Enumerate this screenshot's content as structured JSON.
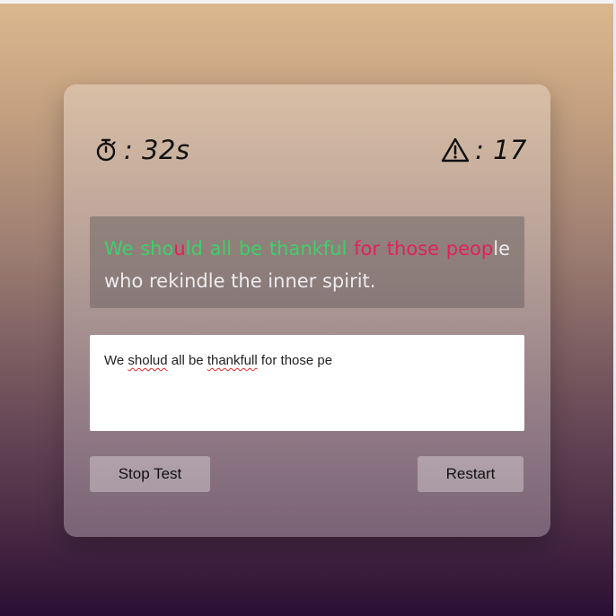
{
  "stats": {
    "timer_icon": "stopwatch-icon",
    "timer_value": ": 32s",
    "errors_icon": "warning-icon",
    "errors_value": ": 17"
  },
  "passage": {
    "segments": [
      {
        "text": "We sho",
        "status": "correct"
      },
      {
        "text": "u",
        "status": "incorrect"
      },
      {
        "text": "l",
        "status": "correct"
      },
      {
        "text": "d",
        "status": "correct"
      },
      {
        "text": " all be thankful ",
        "status": "correct"
      },
      {
        "text": "for those ",
        "status": "incorrect"
      },
      {
        "text": "peop",
        "status": "incorrect"
      },
      {
        "text": "le who rekindle the inner spirit.",
        "status": "pending"
      }
    ]
  },
  "input": {
    "words": [
      {
        "text": "We ",
        "misspelled": false
      },
      {
        "text": "sholud",
        "misspelled": true
      },
      {
        "text": " all be ",
        "misspelled": false
      },
      {
        "text": "thankfull",
        "misspelled": true
      },
      {
        "text": " for those pe",
        "misspelled": false
      }
    ]
  },
  "buttons": {
    "stop_label": "Stop Test",
    "restart_label": "Restart"
  },
  "colors": {
    "correct": "#3fcf6a",
    "incorrect": "#e0225a",
    "pending": "#ecebee"
  }
}
